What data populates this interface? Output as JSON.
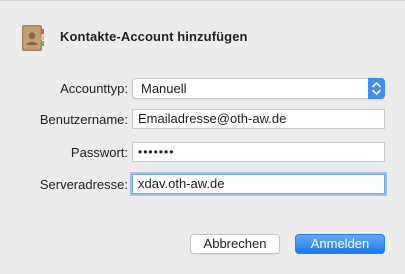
{
  "dialog": {
    "title": "Kontakte-Account hinzufügen",
    "icon": "contacts-app-icon"
  },
  "form": {
    "account_type": {
      "label": "Accounttyp:",
      "value": "Manuell"
    },
    "username": {
      "label": "Benutzername:",
      "value": "Emailadresse@oth-aw.de"
    },
    "password": {
      "label": "Passwort:",
      "masked_value": "•••••••"
    },
    "server": {
      "label": "Serveradresse:",
      "value": "xdav.oth-aw.de"
    }
  },
  "buttons": {
    "cancel_label": "Abbrechen",
    "submit_label": "Anmelden"
  },
  "colors": {
    "accent": "#1b7cf5",
    "background": "#ececec",
    "focus_ring": "#9ec0f3"
  }
}
